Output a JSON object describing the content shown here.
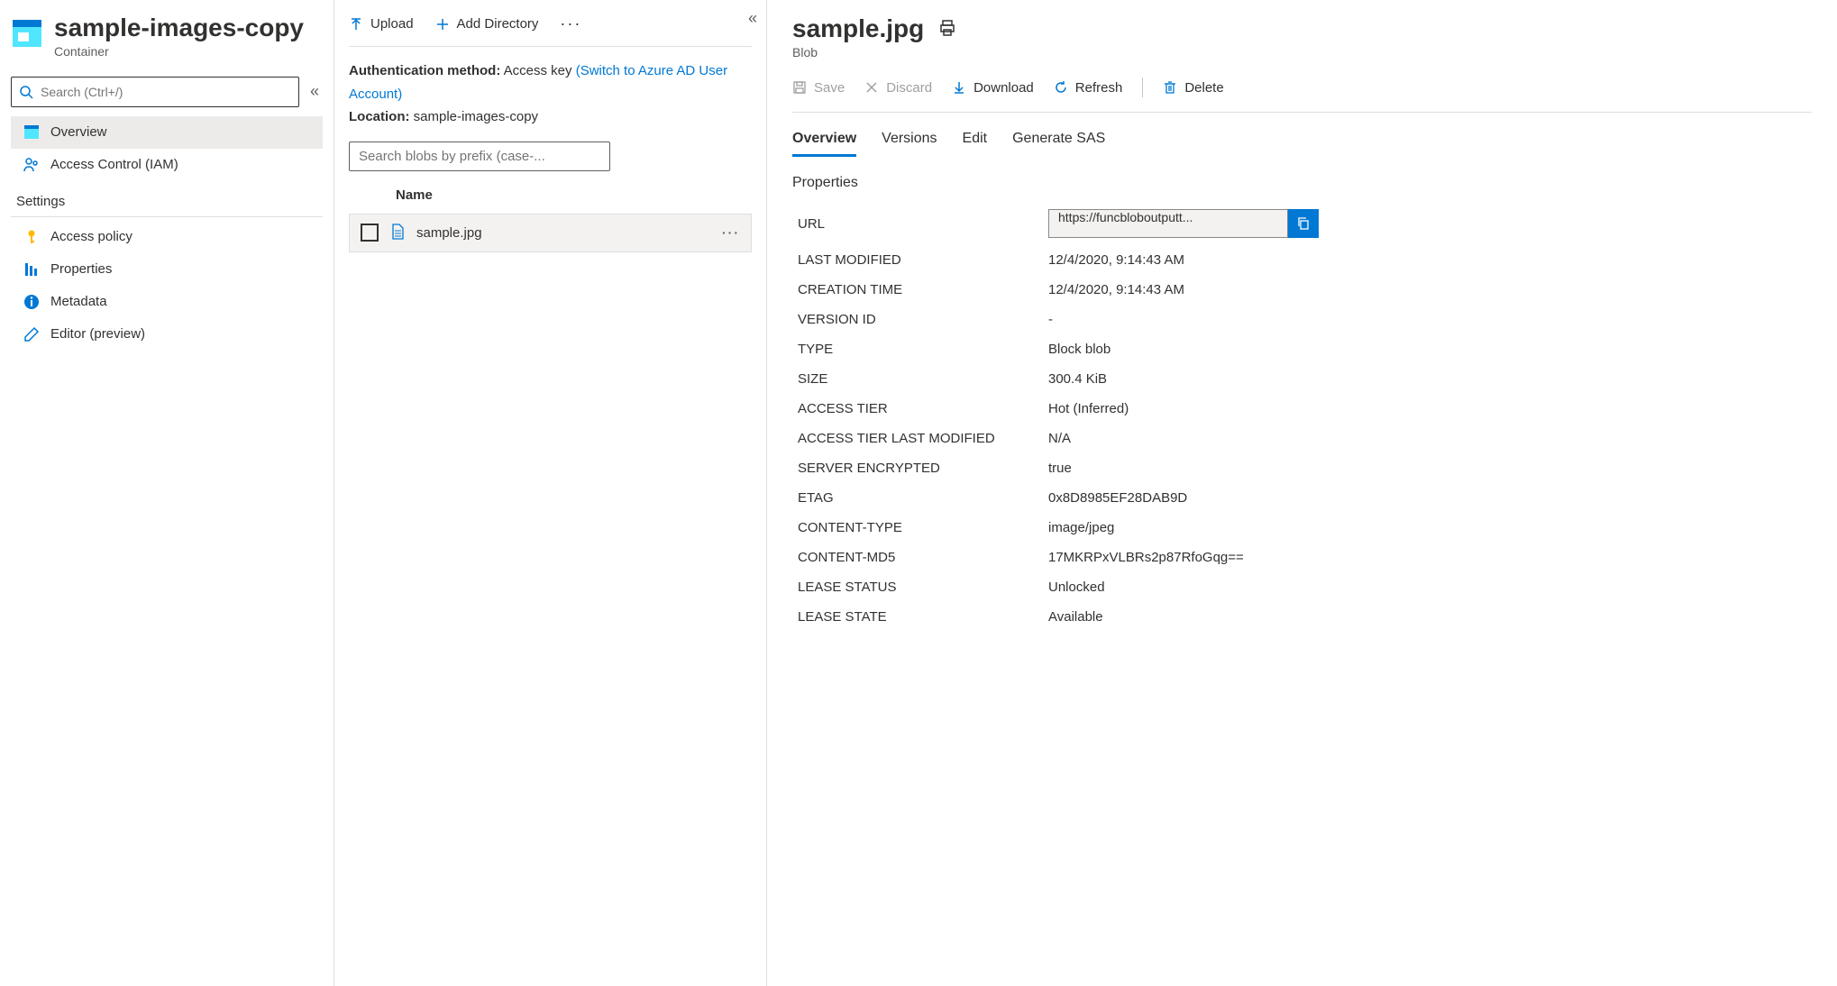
{
  "container": {
    "title": "sample-images-copy",
    "subtitle": "Container"
  },
  "search": {
    "placeholder": "Search (Ctrl+/)"
  },
  "nav": {
    "overview": "Overview",
    "iam": "Access Control (IAM)",
    "settings_header": "Settings",
    "access_policy": "Access policy",
    "properties": "Properties",
    "metadata": "Metadata",
    "editor": "Editor (preview)"
  },
  "toolbar": {
    "upload": "Upload",
    "add_directory": "Add Directory"
  },
  "auth": {
    "method_label": "Authentication method:",
    "method_value": "Access key",
    "switch_link": "(Switch to Azure AD User Account)",
    "location_label": "Location:",
    "location_value": "sample-images-copy"
  },
  "blob_search_placeholder": "Search blobs by prefix (case-...",
  "list": {
    "name_header": "Name",
    "row_name": "sample.jpg"
  },
  "detail": {
    "title": "sample.jpg",
    "subtitle": "Blob",
    "save": "Save",
    "discard": "Discard",
    "download": "Download",
    "refresh": "Refresh",
    "delete": "Delete",
    "tabs": {
      "overview": "Overview",
      "versions": "Versions",
      "edit": "Edit",
      "generate_sas": "Generate SAS"
    },
    "props_heading": "Properties",
    "props": {
      "url_label": "URL",
      "url_value": "https://funcbloboutputt...",
      "last_modified_label": "LAST MODIFIED",
      "last_modified_value": "12/4/2020, 9:14:43 AM",
      "creation_time_label": "CREATION TIME",
      "creation_time_value": "12/4/2020, 9:14:43 AM",
      "version_id_label": "VERSION ID",
      "version_id_value": "-",
      "type_label": "TYPE",
      "type_value": "Block blob",
      "size_label": "SIZE",
      "size_value": "300.4 KiB",
      "access_tier_label": "ACCESS TIER",
      "access_tier_value": "Hot (Inferred)",
      "access_tier_lm_label": "ACCESS TIER LAST MODIFIED",
      "access_tier_lm_value": "N/A",
      "server_encrypted_label": "SERVER ENCRYPTED",
      "server_encrypted_value": "true",
      "etag_label": "ETAG",
      "etag_value": "0x8D8985EF28DAB9D",
      "content_type_label": "CONTENT-TYPE",
      "content_type_value": "image/jpeg",
      "content_md5_label": "CONTENT-MD5",
      "content_md5_value": "17MKRPxVLBRs2p87RfoGqg==",
      "lease_status_label": "LEASE STATUS",
      "lease_status_value": "Unlocked",
      "lease_state_label": "LEASE STATE",
      "lease_state_value": "Available"
    }
  }
}
